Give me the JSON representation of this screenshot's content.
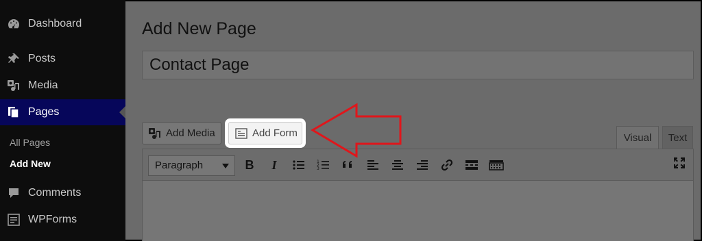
{
  "sidebar": {
    "items": [
      {
        "label": "Dashboard",
        "icon": "dashboard-icon"
      },
      {
        "label": "Posts",
        "icon": "pin-icon"
      },
      {
        "label": "Media",
        "icon": "media-icon"
      },
      {
        "label": "Pages",
        "icon": "pages-icon",
        "active": true
      },
      {
        "label": "Comments",
        "icon": "comment-icon"
      },
      {
        "label": "WPForms",
        "icon": "wpforms-icon"
      }
    ],
    "submenu": [
      {
        "label": "All Pages"
      },
      {
        "label": "Add New",
        "current": true
      }
    ],
    "active_color": "#06065a"
  },
  "main": {
    "page_title": "Add New Page",
    "title_value": "Contact Page",
    "add_media_label": "Add Media",
    "add_form_label": "Add Form",
    "tabs": [
      {
        "label": "Visual",
        "active": true
      },
      {
        "label": "Text"
      }
    ],
    "toolbar": {
      "format_value": "Paragraph",
      "bold": "B",
      "italic": "I",
      "tools": [
        "bullet-list-icon",
        "numbered-list-icon",
        "blockquote-icon",
        "align-left-icon",
        "align-center-icon",
        "align-right-icon",
        "link-icon",
        "read-more-icon",
        "toolbar-toggle-icon",
        "fullscreen-icon"
      ]
    }
  },
  "annotation": {
    "arrow_color": "#e0161b"
  }
}
